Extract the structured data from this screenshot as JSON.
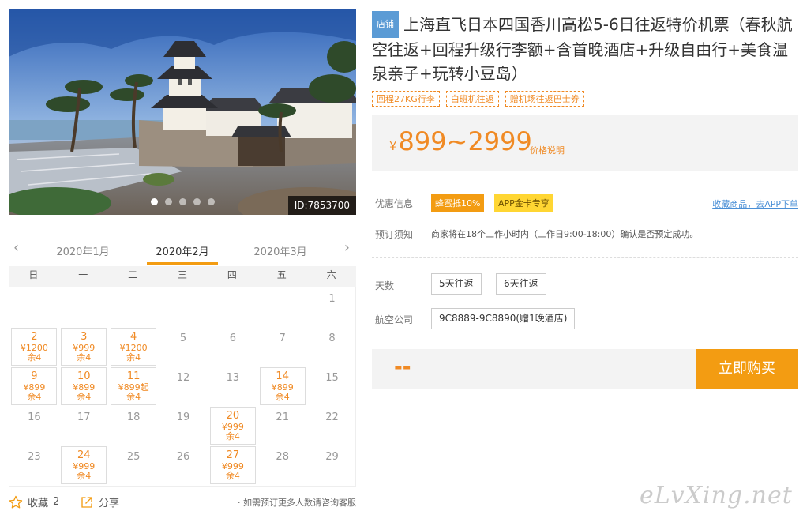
{
  "hero": {
    "id_label": "ID:7853700",
    "slides": 5,
    "active_slide": 0
  },
  "calendar": {
    "prev_arrow": "‹",
    "next_arrow": "›",
    "months": [
      "2020年1月",
      "2020年2月",
      "2020年3月"
    ],
    "active_month": 1,
    "weekdays": [
      "日",
      "一",
      "二",
      "三",
      "四",
      "五",
      "六"
    ],
    "cells": [
      {
        "day": "1",
        "row": 0,
        "col": 6
      },
      {
        "day": "2",
        "row": 1,
        "col": 0,
        "price": "¥1200",
        "remain": "余4"
      },
      {
        "day": "3",
        "row": 1,
        "col": 1,
        "price": "¥999",
        "remain": "余4"
      },
      {
        "day": "4",
        "row": 1,
        "col": 2,
        "price": "¥1200",
        "remain": "余4"
      },
      {
        "day": "5",
        "row": 1,
        "col": 3
      },
      {
        "day": "6",
        "row": 1,
        "col": 4
      },
      {
        "day": "7",
        "row": 1,
        "col": 5
      },
      {
        "day": "8",
        "row": 1,
        "col": 6
      },
      {
        "day": "9",
        "row": 2,
        "col": 0,
        "price": "¥899",
        "remain": "余4"
      },
      {
        "day": "10",
        "row": 2,
        "col": 1,
        "price": "¥899",
        "remain": "余4"
      },
      {
        "day": "11",
        "row": 2,
        "col": 2,
        "price": "¥899起",
        "remain": "余4"
      },
      {
        "day": "12",
        "row": 2,
        "col": 3
      },
      {
        "day": "13",
        "row": 2,
        "col": 4
      },
      {
        "day": "14",
        "row": 2,
        "col": 5,
        "price": "¥899",
        "remain": "余4"
      },
      {
        "day": "15",
        "row": 2,
        "col": 6
      },
      {
        "day": "16",
        "row": 3,
        "col": 0
      },
      {
        "day": "17",
        "row": 3,
        "col": 1
      },
      {
        "day": "18",
        "row": 3,
        "col": 2
      },
      {
        "day": "19",
        "row": 3,
        "col": 3
      },
      {
        "day": "20",
        "row": 3,
        "col": 4,
        "price": "¥999",
        "remain": "余4"
      },
      {
        "day": "21",
        "row": 3,
        "col": 5
      },
      {
        "day": "22",
        "row": 3,
        "col": 6
      },
      {
        "day": "23",
        "row": 4,
        "col": 0
      },
      {
        "day": "24",
        "row": 4,
        "col": 1,
        "price": "¥999",
        "remain": "余4"
      },
      {
        "day": "25",
        "row": 4,
        "col": 2
      },
      {
        "day": "26",
        "row": 4,
        "col": 3
      },
      {
        "day": "27",
        "row": 4,
        "col": 4,
        "price": "¥999",
        "remain": "余4"
      },
      {
        "day": "28",
        "row": 4,
        "col": 5
      },
      {
        "day": "29",
        "row": 4,
        "col": 6
      }
    ]
  },
  "bottom": {
    "favorite_label": "收藏",
    "favorite_count": "2",
    "share_label": "分享",
    "note": "· 如需预订更多人数请咨询客服"
  },
  "product": {
    "shop_tag": "店铺",
    "title": "上海直飞日本四国香川高松5-6日往返特价机票（春秋航空往返+回程升级行李额+含首晚酒店+升级自由行+美食温泉亲子+玩转小豆岛）",
    "tags": [
      "回程27KG行李",
      "白班机往返",
      "赠机场往返巴士券"
    ],
    "currency": "¥",
    "price_range": "899~2999",
    "price_explain": "价格说明",
    "promo_label": "优惠信息",
    "promo_badges": [
      "蜂蜜抵10%",
      "APP金卡专享"
    ],
    "app_link": "收藏商品，去APP下单",
    "booking_label": "预订须知",
    "booking_notice": "商家将在18个工作小时内（工作日9:00-18:00）确认是否预定成功。",
    "days_label": "天数",
    "days_options": [
      "5天往返",
      "6天往返"
    ],
    "airline_label": "航空公司",
    "airline_option": "9C8889-9C8890(赠1晚酒店)",
    "selected_price": "--",
    "buy_button": "立即购买"
  },
  "colors": {
    "accent": "#f39c12",
    "price": "#f08a24",
    "link": "#4a8fd6",
    "shop_tag": "#5b9bd5"
  },
  "watermark": "eLvXing.net"
}
